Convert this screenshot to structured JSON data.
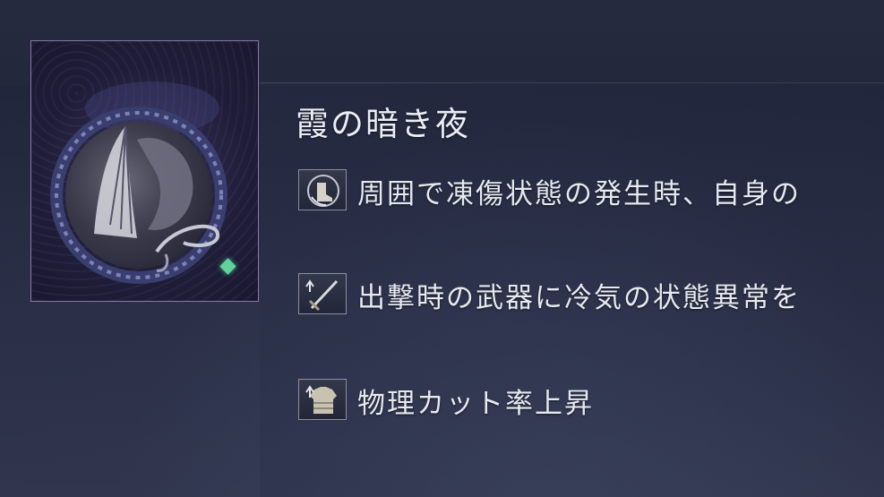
{
  "item": {
    "name": "霞の暗き夜",
    "icon": "dark-night-medallion-icon",
    "rarity_color": "#5fd39a"
  },
  "effects": [
    {
      "icon": "boot-frost-icon",
      "text": "周囲で凍傷状態の発生時、自身の"
    },
    {
      "icon": "sword-up-icon",
      "text": "出撃時の武器に冷気の状態異常を"
    },
    {
      "icon": "armor-up-icon",
      "text": "物理カット率上昇"
    }
  ]
}
